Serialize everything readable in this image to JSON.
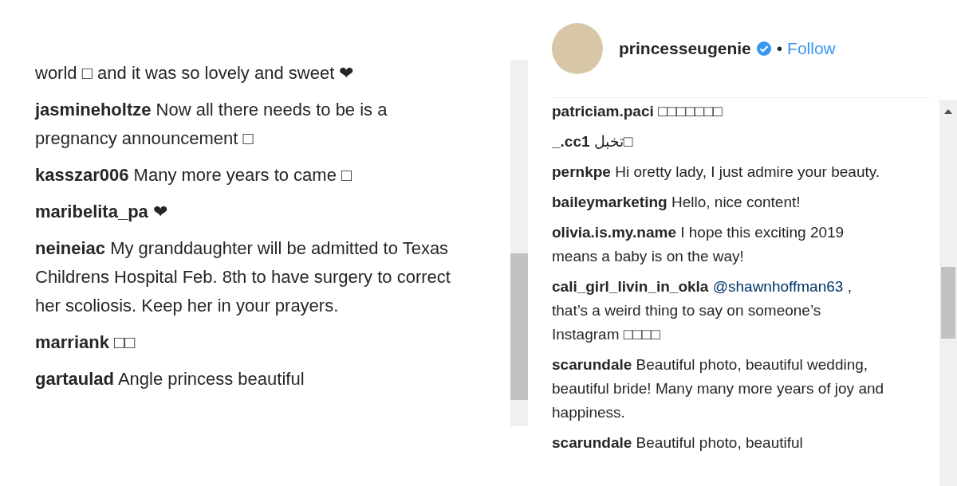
{
  "left_comments": [
    {
      "parts": [
        {
          "kind": "text",
          "text": "world □ and it was so lovely and sweet ❤"
        }
      ]
    },
    {
      "user": "jasmineholtze",
      "parts": [
        {
          "kind": "text",
          "text": "Now all there needs to be is a pregnancy announcement □"
        }
      ]
    },
    {
      "user": "kasszar006",
      "parts": [
        {
          "kind": "text",
          "text": "Many more years to came □"
        }
      ]
    },
    {
      "user": "maribelita_pa",
      "parts": [
        {
          "kind": "text",
          "text": "❤"
        }
      ]
    },
    {
      "user": "neineiac",
      "parts": [
        {
          "kind": "text",
          "text": "My granddaughter will be admitted to Texas Childrens Hospital Feb. 8th to have surgery to correct her scoliosis. Keep her in your prayers."
        }
      ]
    },
    {
      "user": "marriank",
      "parts": [
        {
          "kind": "text",
          "text": "□□"
        }
      ]
    },
    {
      "user": "gartaulad",
      "parts": [
        {
          "kind": "text",
          "text": "Angle princess beautiful"
        }
      ]
    }
  ],
  "post_header": {
    "username": "princesseugenie",
    "verified": true,
    "separator": "•",
    "follow": "Follow"
  },
  "right_comments": [
    {
      "user": "patriciam.paci",
      "parts": [
        {
          "kind": "text",
          "text": "□□□□□□□"
        }
      ]
    },
    {
      "user": "_.cc1",
      "parts": [
        {
          "kind": "text",
          "text": "تخبل□"
        }
      ]
    },
    {
      "user": "pernkpe",
      "parts": [
        {
          "kind": "text",
          "text": "Hi oretty lady, I just admire your beauty."
        }
      ]
    },
    {
      "user": "baileymarketing",
      "parts": [
        {
          "kind": "text",
          "text": "Hello, nice content!"
        }
      ]
    },
    {
      "user": "olivia.is.my.name",
      "parts": [
        {
          "kind": "text",
          "text": "I hope this exciting 2019 means a baby is on the way!"
        }
      ]
    },
    {
      "user": "cali_girl_livin_in_okla",
      "parts": [
        {
          "kind": "mention",
          "text": "@shawnhoffman63"
        },
        {
          "kind": "text",
          "text": " , that’s a weird thing to say on someone’s Instagram □□□□"
        }
      ]
    },
    {
      "user": "scarundale",
      "parts": [
        {
          "kind": "text",
          "text": "Beautiful photo, beautiful wedding, beautiful bride! Many many more years of joy and happiness."
        }
      ]
    },
    {
      "user": "scarundale",
      "parts": [
        {
          "kind": "text",
          "text": "Beautiful photo, beautiful"
        }
      ]
    }
  ]
}
